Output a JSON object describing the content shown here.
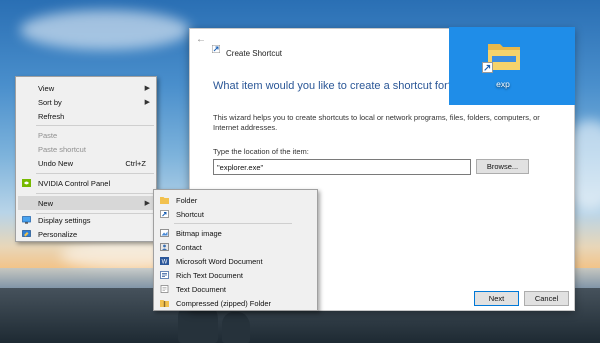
{
  "wizard": {
    "title": "Create Shortcut",
    "heading": "What item would you like to create a shortcut for?",
    "description": "This wizard helps you to create shortcuts to local or network programs, files, folders, computers, or Internet addresses.",
    "field_label": "Type the location of the item:",
    "location_value": "\"explorer.exe\"",
    "browse_label": "Browse...",
    "next_label": "Next",
    "cancel_label": "Cancel"
  },
  "desktop_icon": {
    "label": "exp"
  },
  "context_menu": {
    "items": [
      {
        "label": "View",
        "icon": "",
        "submenu": true
      },
      {
        "label": "Sort by",
        "icon": "",
        "submenu": true
      },
      {
        "label": "Refresh",
        "icon": ""
      },
      {
        "label": "Paste",
        "disabled": true
      },
      {
        "label": "Paste shortcut",
        "disabled": true
      },
      {
        "label": "Undo New",
        "shortcut": "Ctrl+Z"
      },
      {
        "label": "NVIDIA Control Panel",
        "icon": "nvidia-icon"
      },
      {
        "label": "New",
        "submenu": true
      },
      {
        "label": "Display settings",
        "icon": "display-icon"
      },
      {
        "label": "Personalize",
        "icon": "personalize-icon"
      }
    ]
  },
  "new_submenu": {
    "items": [
      {
        "label": "Folder",
        "icon": "folder-icon"
      },
      {
        "label": "Shortcut",
        "icon": "shortcut-icon"
      },
      {
        "label": "Bitmap image",
        "icon": "bitmap-icon"
      },
      {
        "label": "Contact",
        "icon": "contact-icon"
      },
      {
        "label": "Microsoft Word Document",
        "icon": "word-icon"
      },
      {
        "label": "Rich Text Document",
        "icon": "rtf-icon"
      },
      {
        "label": "Text Document",
        "icon": "text-icon"
      },
      {
        "label": "Compressed (zipped) Folder",
        "icon": "zip-folder-icon"
      }
    ]
  },
  "colors": {
    "accent": "#0078d7",
    "heading": "#2b5797",
    "menu_bg": "#f0f0f0",
    "menu_highlight": "#d7d7d7"
  }
}
